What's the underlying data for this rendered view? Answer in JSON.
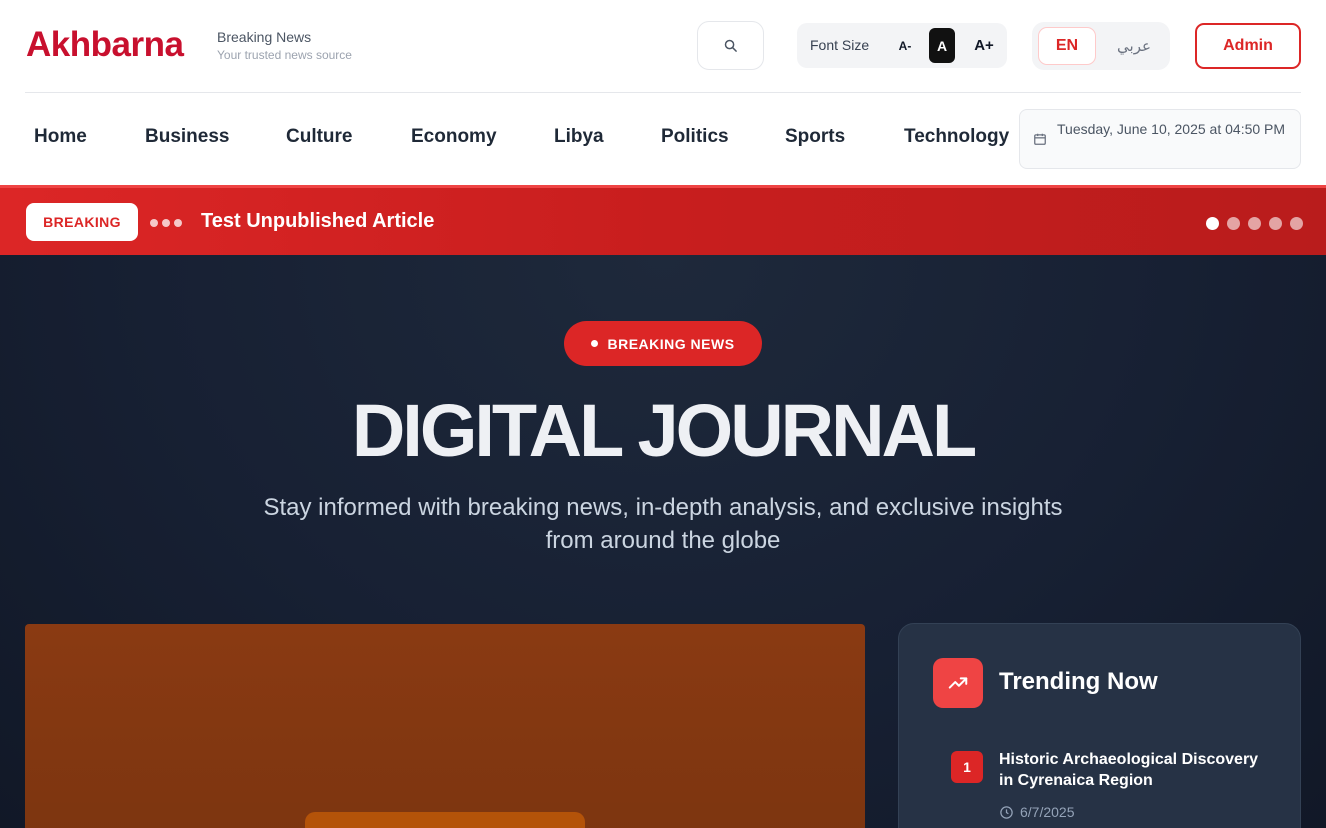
{
  "header": {
    "logo": "Akhbarna",
    "tagline_title": "Breaking News",
    "tagline_sub": "Your trusted news source",
    "font_size_label": "Font Size",
    "font_minus": "A-",
    "font_normal": "A",
    "font_plus": "A+",
    "lang_en": "EN",
    "lang_ar": "عربي",
    "admin_label": "Admin"
  },
  "nav": {
    "items": [
      "Home",
      "Business",
      "Culture",
      "Economy",
      "Libya",
      "Politics",
      "Sports",
      "Technology"
    ],
    "date": "Tuesday, June 10, 2025 at 04:50 PM"
  },
  "breaking": {
    "label": "BREAKING",
    "headline": "Test Unpublished Article",
    "pages": 5,
    "active_page": 1
  },
  "hero": {
    "badge": "BREAKING NEWS",
    "title": "DIGITAL JOURNAL",
    "subtitle": "Stay informed with breaking news, in-depth analysis, and exclusive insights from around the globe"
  },
  "trending": {
    "title": "Trending Now",
    "items": [
      {
        "rank": "1",
        "title": "Historic Archaeological Discovery in Cyrenaica Region",
        "date": "6/7/2025"
      }
    ]
  },
  "colors": {
    "brand": "#c8102e",
    "accent": "#dc2626",
    "hero_bg": "#172033"
  },
  "icons": {
    "search": "search-icon",
    "calendar": "calendar-icon",
    "trending": "trending-up-icon",
    "clock": "clock-icon"
  }
}
